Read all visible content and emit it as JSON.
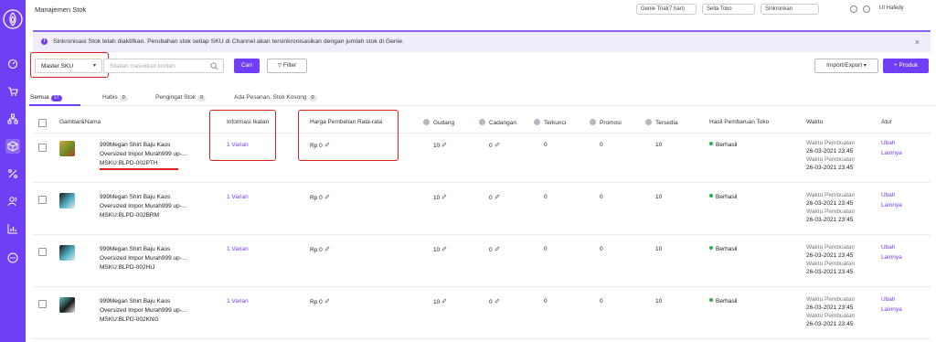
{
  "page": {
    "title": "Manajemen Stok"
  },
  "topbar": {
    "trial_label": "Genie Trial(7 hari)",
    "sale_label": "Sella Toko",
    "sync_label": "Sinkronkan",
    "user_label": "UI Hafedy"
  },
  "notice": {
    "text": "Sinkronisasi Stok telah diaktifkan. Perubahan stok setiap SKU di Channel akan tersinkronisasikan dengan jumlah stok di Genie.",
    "close": "×"
  },
  "toolbar": {
    "filter_select_value": "Master SKU",
    "search_placeholder": "Silakan masukkan konten",
    "search_button": "Cari",
    "filter_button": "Filter",
    "import_export_button": "Import/Export",
    "add_product_button": "+ Produk"
  },
  "tabs": [
    {
      "label": "Semua",
      "count": "17"
    },
    {
      "label": "Habis",
      "count": "0"
    },
    {
      "label": "Pengingat Stok",
      "count": "0"
    },
    {
      "label": "Ada Pesanan, Stok Kosong",
      "count": "0"
    }
  ],
  "table": {
    "headers": {
      "image_name": "Gambar&Nama",
      "bundle": "Informasi Ikatan",
      "avg_price": "Harga Pembelian Rata-rata",
      "warehouse": "Gudang",
      "reserve": "Cadangan",
      "locked": "Terkunci",
      "promo": "Promosi",
      "available": "Tersedia",
      "store_update": "Hasil Pembaruan Toko",
      "time": "Waktu",
      "manage": "Atur"
    },
    "rows": [
      {
        "name_line1": "999Megan Shirt Baju Kaos",
        "name_line2": "Oversized Impor Murah999 up-...",
        "msku": "MSKU:BLPD-002PTH",
        "bundle": "1 Varian",
        "avg_price": "Rp 0",
        "warehouse": "10",
        "reserve": "0",
        "locked": "0",
        "promo": "0",
        "available": "10",
        "store_update": "Berhasil",
        "created_label": "Waktu Pembuatan",
        "created_time": "26-03-2021 23:45",
        "updated_label": "Waktu Pembuatan",
        "updated_time": "26-03-2021 23:45",
        "action_edit": "Ubah",
        "action_more": "Lainnya"
      },
      {
        "name_line1": "999Megan Shirt Baju Kaos",
        "name_line2": "Oversized Impor Murah999 up-...",
        "msku": "MSKU:BLPD-002BRM",
        "bundle": "1 Varian",
        "avg_price": "Rp 0",
        "warehouse": "10",
        "reserve": "0",
        "locked": "0",
        "promo": "0",
        "available": "10",
        "store_update": "Berhasil",
        "created_label": "Waktu Pembuatan",
        "created_time": "26-03-2021 23:45",
        "updated_label": "Waktu Pembuatan",
        "updated_time": "26-03-2021 23:45",
        "action_edit": "Ubah",
        "action_more": "Lainnya"
      },
      {
        "name_line1": "999Megan Shirt Baju Kaos",
        "name_line2": "Oversized Impor Murah999 up-...",
        "msku": "MSKU:BLPD-002HIJ",
        "bundle": "1 Varian",
        "avg_price": "Rp 0",
        "warehouse": "10",
        "reserve": "0",
        "locked": "0",
        "promo": "0",
        "available": "10",
        "store_update": "Berhasil",
        "created_label": "Waktu Pembuatan",
        "created_time": "26-03-2021 23:45",
        "updated_label": "Waktu Pembuatan",
        "updated_time": "26-03-2021 23:45",
        "action_edit": "Ubah",
        "action_more": "Lainnya"
      },
      {
        "name_line1": "999Megan Shirt Baju Kaos",
        "name_line2": "Oversized Impor Murah999 up-...",
        "msku": "MSKU:BLPD-002KNG",
        "bundle": "1 Varian",
        "avg_price": "Rp 0",
        "warehouse": "10",
        "reserve": "0",
        "locked": "0",
        "promo": "0",
        "available": "10",
        "store_update": "Berhasil",
        "created_label": "Waktu Pembuatan",
        "created_time": "26-03-2021 23:45",
        "updated_label": "Waktu Pembuatan",
        "updated_time": "26-03-2021 23:45",
        "action_edit": "Ubah",
        "action_more": "Lainnya"
      }
    ]
  },
  "colors": {
    "brand": "#6f3ff5",
    "highlight": "#e02020",
    "success": "#2bb24c"
  },
  "icons": {
    "sidebar": [
      "logo-icon",
      "dashboard-icon",
      "cart-icon",
      "network-icon",
      "box-icon",
      "percent-icon",
      "users-icon",
      "chart-icon",
      "chat-icon"
    ]
  }
}
